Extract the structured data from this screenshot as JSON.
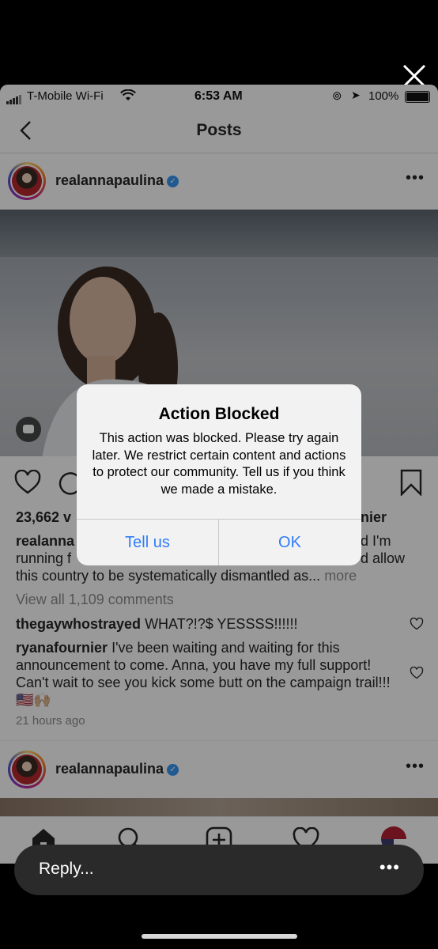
{
  "status_bar": {
    "carrier": "T-Mobile Wi-Fi",
    "time": "6:53 AM",
    "battery": "100%"
  },
  "nav": {
    "title": "Posts",
    "back_icon": "chevron-left-icon"
  },
  "post1": {
    "username": "realannapaulina",
    "likes": "23,662 v",
    "liked_by_tail": "nier",
    "caption_line1_start": "realanna",
    "caption_line1_end": "d I'm",
    "caption_line2_start": "running f",
    "caption_line2_end": "d allow",
    "caption_line3": "this country to be systematically dismantled as...",
    "more": "more",
    "view_comments": "View all 1,109 comments",
    "comments": [
      {
        "user": "thegaywhostrayed",
        "text": "WHAT?!?$ YESSSS!!!!!!"
      },
      {
        "user": "ryanafournier",
        "text": "I've been waiting and waiting for this announcement to come. Anna, you have my full support! Can't wait to see you kick some butt on the campaign trail!!! 🇺🇸🙌🏼"
      }
    ],
    "time_ago": "21 hours ago"
  },
  "post2": {
    "username": "realannapaulina"
  },
  "alert": {
    "title": "Action Blocked",
    "message": "This action was blocked. Please try again later. We restrict certain content and actions to protect our community. Tell us if you think we made a mistake.",
    "left_button": "Tell us",
    "right_button": "OK"
  },
  "reply": {
    "placeholder": "Reply..."
  },
  "colors": {
    "accent_blue": "#2e7cf6",
    "verified_blue": "#3897f0",
    "dim_overlay": "rgba(0,0,0,0.40)"
  }
}
